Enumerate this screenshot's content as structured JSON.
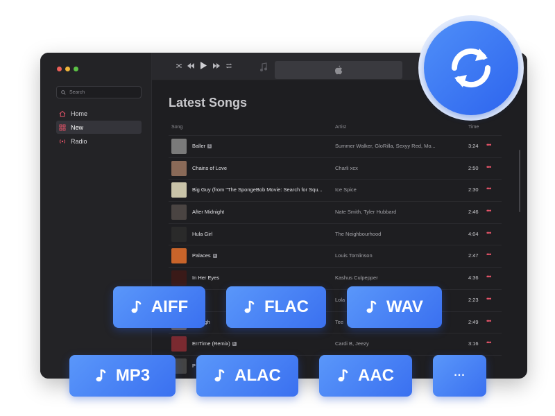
{
  "search": {
    "placeholder": "Search"
  },
  "sidebar": {
    "items": [
      {
        "label": "Home",
        "icon": "home-icon"
      },
      {
        "label": "New",
        "icon": "grid-icon"
      },
      {
        "label": "Radio",
        "icon": "radio-icon"
      }
    ]
  },
  "main": {
    "title": "Latest Songs",
    "columns": {
      "song": "Song",
      "artist": "Artist",
      "time": "Time"
    }
  },
  "songs": [
    {
      "title": "Baller",
      "explicit": true,
      "artist": "Summer Walker, GloRilla, Sexyy Red, Mo...",
      "time": "3:24",
      "color": "#7a7a7a"
    },
    {
      "title": "Chains of Love",
      "explicit": false,
      "artist": "Charli xcx",
      "time": "2:50",
      "color": "#8a6a58"
    },
    {
      "title": "Big Guy (from \"The SpongeBob Movie: Search for Squ...",
      "explicit": false,
      "artist": "Ice Spice",
      "time": "2:30",
      "color": "#c9c3a8"
    },
    {
      "title": "After Midnight",
      "explicit": false,
      "artist": "Nate Smith, Tyler Hubbard",
      "time": "2:46",
      "color": "#4a4442"
    },
    {
      "title": "Hula Girl",
      "explicit": false,
      "artist": "The Neighbourhood",
      "time": "4:04",
      "color": "#2a2a2a"
    },
    {
      "title": "Palaces",
      "explicit": true,
      "artist": "Louis Tomlinson",
      "time": "2:47",
      "color": "#c8642a"
    },
    {
      "title": "In Her Eyes",
      "explicit": false,
      "artist": "Kashus Culpepper",
      "time": "4:36",
      "color": "#3a1a18"
    },
    {
      "title": "",
      "explicit": true,
      "artist": "Lola",
      "time": "2:23",
      "color": "#5a4a3a"
    },
    {
      "title": "Enough",
      "explicit": false,
      "artist": "Tee",
      "time": "2:49",
      "color": "#6a5a4a"
    },
    {
      "title": "ErrTime (Remix)",
      "explicit": true,
      "artist": "Cardi B, Jeezy",
      "time": "3:16",
      "color": "#7a2a30"
    },
    {
      "title": "P",
      "explicit": false,
      "artist": "",
      "time": "",
      "color": "#444"
    }
  ],
  "more_glyph": "•••",
  "formats": [
    "AIFF",
    "FLAC",
    "WAV",
    "MP3",
    "ALAC",
    "AAC",
    "..."
  ],
  "colors": {
    "accent": "#3a70f0",
    "pink": "#e9556a"
  }
}
